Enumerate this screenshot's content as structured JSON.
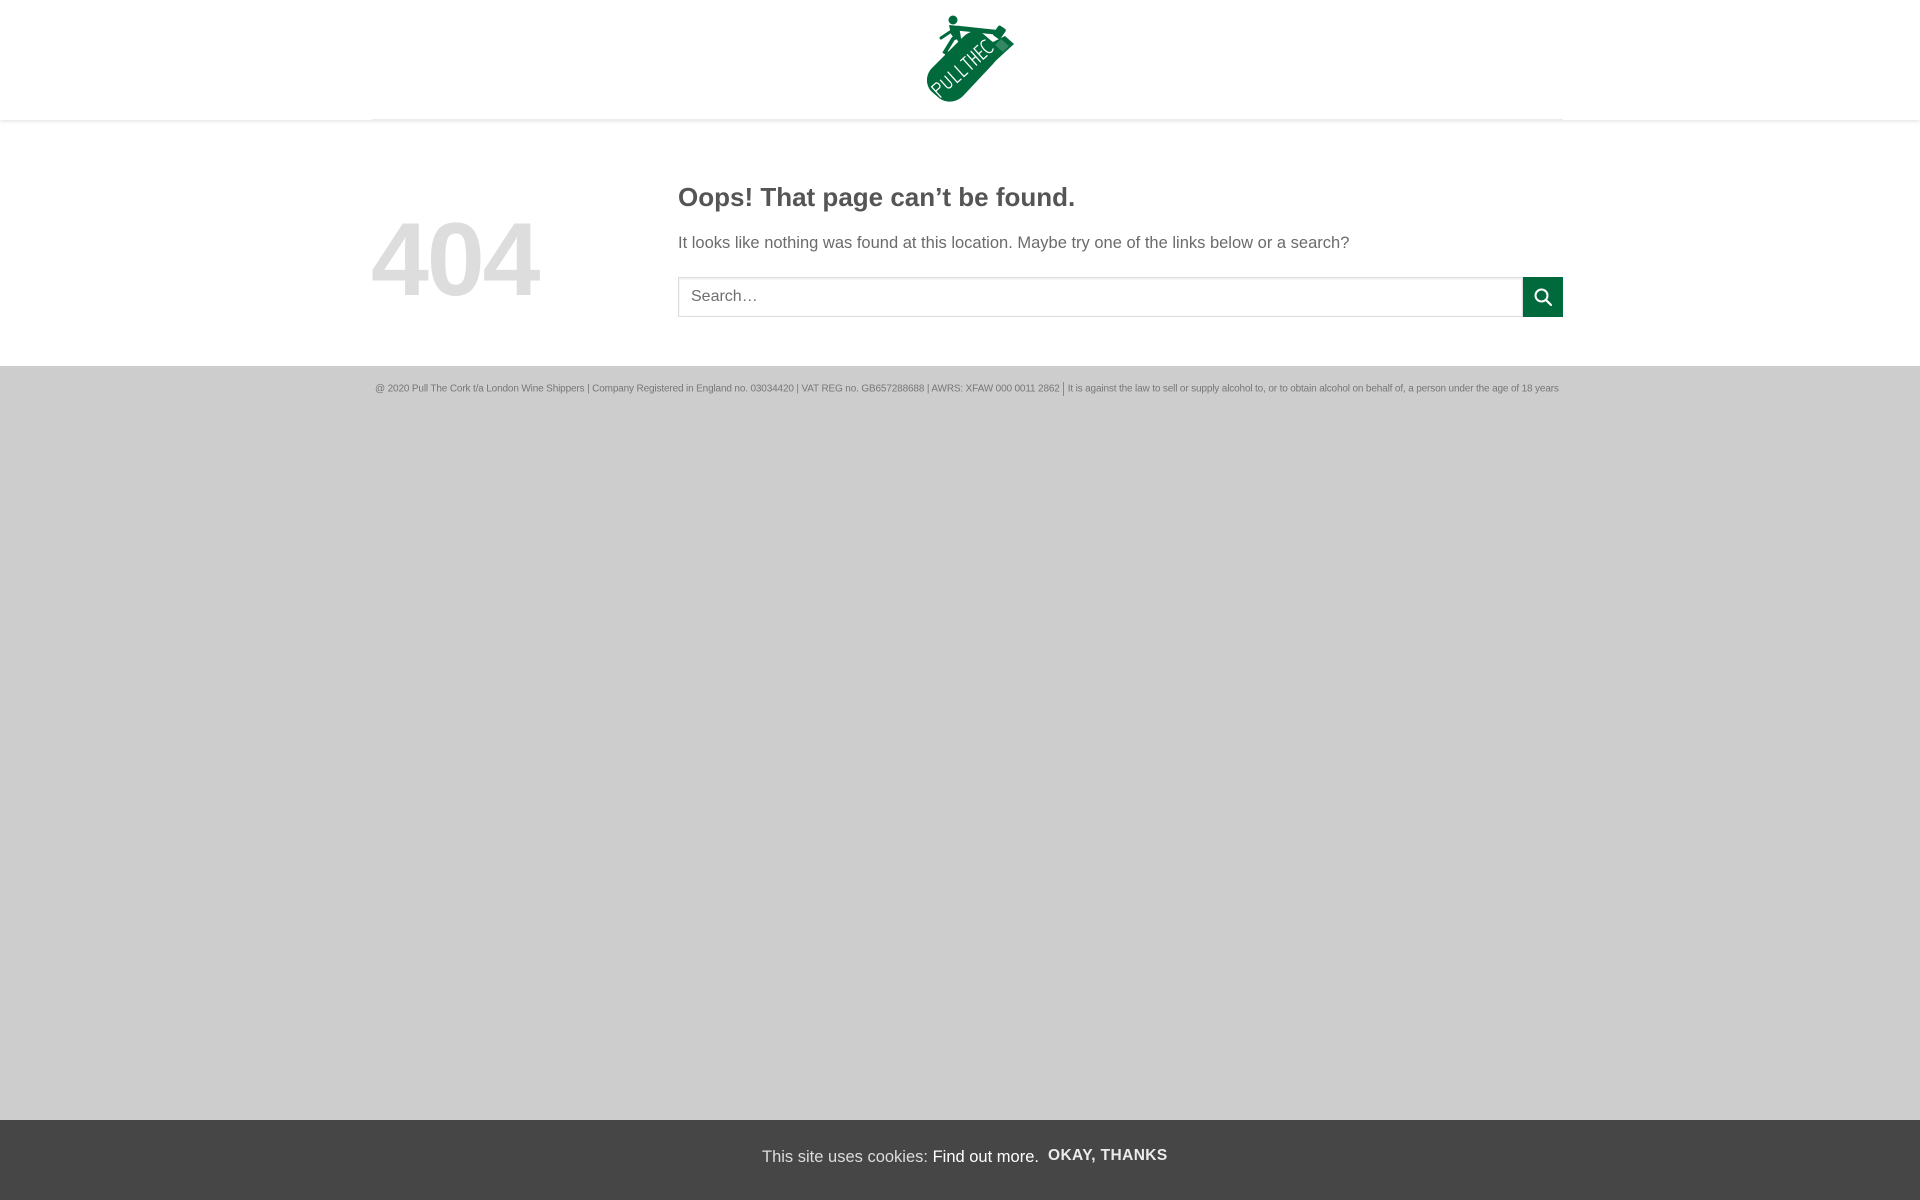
{
  "header": {
    "logo_text": "PULLTHECORK",
    "brand_color": "#006a3c"
  },
  "error_page": {
    "code": "404",
    "title": "Oops! That page can’t be found.",
    "message": "It looks like nothing was found at this location. Maybe try one of the links below or a search?",
    "search_placeholder": "Search…",
    "search_button_icon": "search-icon"
  },
  "footer": {
    "legal": "@ 2020 Pull The Cork t/a London Wine Shippers | Company Registered in England no. 03034420 | VAT REG no. GB657288688 | AWRS: XFAW 000 0011 2862",
    "age_notice": "It is against the law to sell or supply alcohol to, or to obtain alcohol on behalf of, a person under the age of 18 years"
  },
  "cookie_bar": {
    "text": "This site uses cookies:",
    "link_label": "Find out more.",
    "accept_label": "OKAY, THANKS"
  }
}
